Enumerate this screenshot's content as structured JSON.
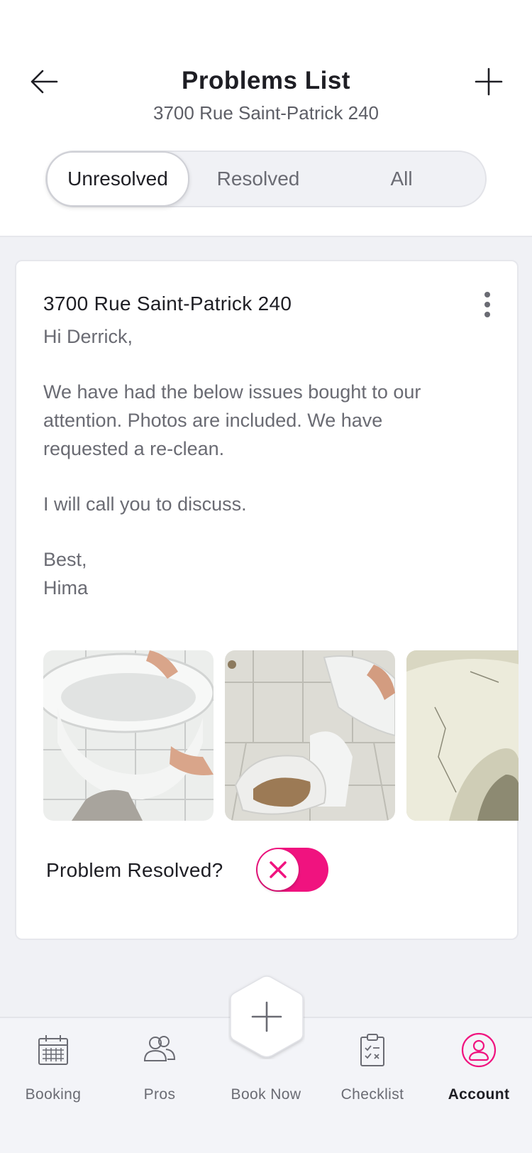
{
  "header": {
    "title": "Problems List",
    "subtitle": "3700 Rue Saint-Patrick 240",
    "back_icon": "arrow-left-icon",
    "add_icon": "plus-icon"
  },
  "filter": {
    "options": [
      "Unresolved",
      "Resolved",
      "All"
    ],
    "selected": "Unresolved"
  },
  "problem": {
    "title": "3700 Rue Saint-Patrick 240",
    "greeting": "Hi Derrick,",
    "body_lines": [
      "We have had the below issues bought to our",
      "attention. Photos are included. We have",
      "requested a re-clean."
    ],
    "call_line": "I will call you to discuss.",
    "signoff": "Best,",
    "signature": "Hima",
    "resolved_label": "Problem Resolved?",
    "resolved": false
  },
  "nav": {
    "items": [
      {
        "label": "Booking",
        "icon": "calendar-icon"
      },
      {
        "label": "Pros",
        "icon": "users-icon"
      },
      {
        "label": "Book Now",
        "icon": "plus-icon"
      },
      {
        "label": "Checklist",
        "icon": "clipboard-check-icon"
      },
      {
        "label": "Account",
        "icon": "user-circle-icon"
      }
    ],
    "active": "Account"
  },
  "colors": {
    "accent": "#f0137f",
    "background": "#f0f1f5",
    "text_muted": "#6a6b73"
  }
}
